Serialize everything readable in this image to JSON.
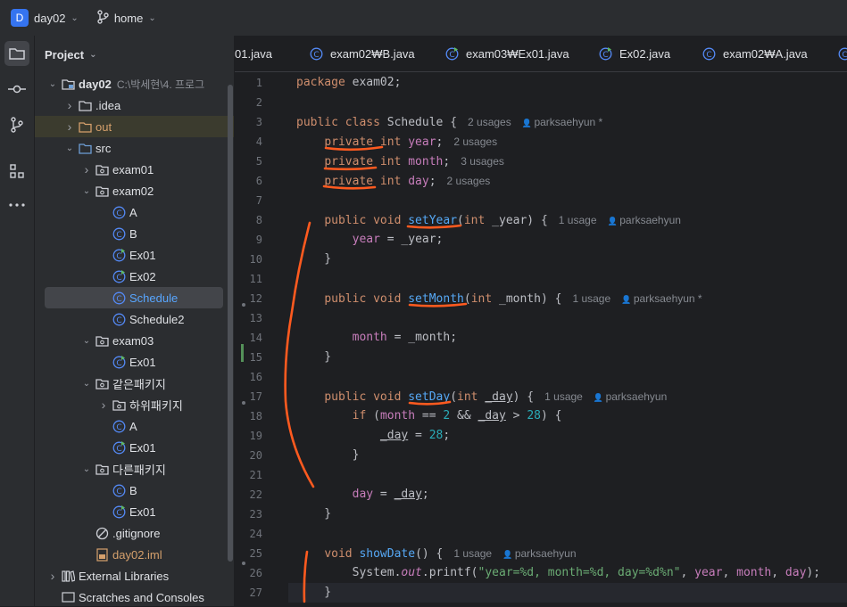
{
  "titlebar": {
    "project_badge": "D",
    "project_name": "day02",
    "branch": "home"
  },
  "toolstrip": {
    "icons": [
      "folder-icon",
      "commit-icon",
      "git-branches-icon",
      "structure-icon",
      "more-icon"
    ]
  },
  "project_panel": {
    "header": "Project",
    "tree": [
      {
        "label": "day02",
        "extra": "C:\\박세현\\4. 프로그",
        "level": 0,
        "expanded": true,
        "icon": "module-folder",
        "bold": true
      },
      {
        "label": ".idea",
        "level": 1,
        "expanded": false,
        "icon": "folder"
      },
      {
        "label": "out",
        "level": 1,
        "expanded": false,
        "icon": "folder-orange",
        "color": "orange",
        "highlight": true
      },
      {
        "label": "src",
        "level": 1,
        "expanded": true,
        "icon": "source-folder"
      },
      {
        "label": "exam01",
        "level": 2,
        "expanded": false,
        "icon": "package"
      },
      {
        "label": "exam02",
        "level": 2,
        "expanded": true,
        "icon": "package"
      },
      {
        "label": "A",
        "level": 3,
        "icon": "class"
      },
      {
        "label": "B",
        "level": 3,
        "icon": "class"
      },
      {
        "label": "Ex01",
        "level": 3,
        "icon": "class-runnable"
      },
      {
        "label": "Ex02",
        "level": 3,
        "icon": "class-runnable"
      },
      {
        "label": "Schedule",
        "level": 3,
        "icon": "class",
        "selected": true,
        "color": "blue"
      },
      {
        "label": "Schedule2",
        "level": 3,
        "icon": "class"
      },
      {
        "label": "exam03",
        "level": 2,
        "expanded": true,
        "icon": "package"
      },
      {
        "label": "Ex01",
        "level": 3,
        "icon": "class-runnable"
      },
      {
        "label": "같은패키지",
        "level": 2,
        "expanded": true,
        "icon": "package"
      },
      {
        "label": "하위패키지",
        "level": 3,
        "expanded": false,
        "icon": "package"
      },
      {
        "label": "A",
        "level": 3,
        "icon": "class"
      },
      {
        "label": "Ex01",
        "level": 3,
        "icon": "class-runnable"
      },
      {
        "label": "다른패키지",
        "level": 2,
        "expanded": true,
        "icon": "package"
      },
      {
        "label": "B",
        "level": 3,
        "icon": "class"
      },
      {
        "label": "Ex01",
        "level": 3,
        "icon": "class-runnable"
      },
      {
        "label": ".gitignore",
        "level": 2,
        "icon": "ignore-file"
      },
      {
        "label": "day02.iml",
        "level": 2,
        "icon": "iml-file",
        "color": "orange"
      },
      {
        "label": "External Libraries",
        "level": 0,
        "expanded": false,
        "icon": "libraries"
      },
      {
        "label": "Scratches and Consoles",
        "level": 0,
        "icon": "scratches"
      }
    ]
  },
  "tabs": [
    {
      "label": "01.java",
      "icon": "none"
    },
    {
      "label": "exam02₩B.java",
      "icon": "class"
    },
    {
      "label": "exam03₩Ex01.java",
      "icon": "class-runnable"
    },
    {
      "label": "Ex02.java",
      "icon": "class-runnable"
    },
    {
      "label": "exam02₩A.java",
      "icon": "class"
    },
    {
      "label": "",
      "icon": "class"
    }
  ],
  "editor": {
    "current_line": 27,
    "lines": [
      {
        "n": "1",
        "code": [
          [
            "kw",
            "package "
          ],
          [
            "",
            "exam02;"
          ]
        ]
      },
      {
        "n": "2",
        "code": []
      },
      {
        "n": "3",
        "code": [
          [
            "kw",
            "public class "
          ],
          [
            "",
            "Schedule {"
          ]
        ],
        "hint": "2 usages",
        "user": "parksaehyun *"
      },
      {
        "n": "4",
        "code": [
          [
            "",
            "    "
          ],
          [
            "kw",
            "private int "
          ],
          [
            "fld",
            "year"
          ],
          [
            "",
            ";"
          ]
        ],
        "hint": "2 usages"
      },
      {
        "n": "5",
        "code": [
          [
            "",
            "    "
          ],
          [
            "kw",
            "private int "
          ],
          [
            "fld",
            "month"
          ],
          [
            "",
            ";"
          ]
        ],
        "hint": "3 usages"
      },
      {
        "n": "6",
        "code": [
          [
            "",
            "    "
          ],
          [
            "kw",
            "private int "
          ],
          [
            "fld",
            "day"
          ],
          [
            "",
            ";"
          ]
        ],
        "hint": "2 usages"
      },
      {
        "n": "7",
        "code": []
      },
      {
        "n": "8",
        "code": [
          [
            "",
            "    "
          ],
          [
            "kw",
            "public void "
          ],
          [
            "fn",
            "setYear"
          ],
          [
            "",
            "("
          ],
          [
            "kw",
            "int "
          ],
          [
            "",
            "_year) {"
          ]
        ],
        "hint": "1 usage",
        "user": "parksaehyun"
      },
      {
        "n": "9",
        "code": [
          [
            "",
            "        "
          ],
          [
            "fld",
            "year"
          ],
          [
            "",
            " = _year;"
          ]
        ]
      },
      {
        "n": "10",
        "code": [
          [
            "",
            "    }"
          ]
        ]
      },
      {
        "n": "11",
        "code": []
      },
      {
        "n": "12",
        "code": [
          [
            "",
            "    "
          ],
          [
            "kw",
            "public void "
          ],
          [
            "fn",
            "setMonth"
          ],
          [
            "",
            "("
          ],
          [
            "kw",
            "int "
          ],
          [
            "",
            "_month) {"
          ]
        ],
        "hint": "1 usage",
        "user": "parksaehyun *"
      },
      {
        "n": "13",
        "code": []
      },
      {
        "n": "14",
        "code": [
          [
            "",
            "        "
          ],
          [
            "fld",
            "month"
          ],
          [
            "",
            " = _month;"
          ]
        ]
      },
      {
        "n": "15",
        "code": [
          [
            "",
            "    }"
          ]
        ]
      },
      {
        "n": "16",
        "code": []
      },
      {
        "n": "17",
        "code": [
          [
            "",
            "    "
          ],
          [
            "kw",
            "public void "
          ],
          [
            "fn",
            "setDay"
          ],
          [
            "",
            "("
          ],
          [
            "kw",
            "int "
          ],
          [
            "ul",
            "_day"
          ],
          [
            "",
            ") {"
          ]
        ],
        "hint": "1 usage",
        "user": "parksaehyun"
      },
      {
        "n": "18",
        "code": [
          [
            "",
            "        "
          ],
          [
            "kw",
            "if "
          ],
          [
            "",
            "("
          ],
          [
            "fld",
            "month"
          ],
          [
            "",
            " == "
          ],
          [
            "num",
            "2"
          ],
          [
            "",
            " && "
          ],
          [
            "ul",
            "_day"
          ],
          [
            "",
            " > "
          ],
          [
            "num",
            "28"
          ],
          [
            "",
            ") {"
          ]
        ]
      },
      {
        "n": "19",
        "code": [
          [
            "",
            "            "
          ],
          [
            "ul",
            "_day"
          ],
          [
            "",
            " = "
          ],
          [
            "num",
            "28"
          ],
          [
            "",
            ";"
          ]
        ]
      },
      {
        "n": "20",
        "code": [
          [
            "",
            "        }"
          ]
        ]
      },
      {
        "n": "21",
        "code": []
      },
      {
        "n": "22",
        "code": [
          [
            "",
            "        "
          ],
          [
            "fld",
            "day"
          ],
          [
            "",
            " = "
          ],
          [
            "ul",
            "_day"
          ],
          [
            "",
            ";"
          ]
        ]
      },
      {
        "n": "23",
        "code": [
          [
            "",
            "    }"
          ]
        ]
      },
      {
        "n": "24",
        "code": []
      },
      {
        "n": "25",
        "code": [
          [
            "",
            "    "
          ],
          [
            "kw",
            "void "
          ],
          [
            "fn",
            "showDate"
          ],
          [
            "",
            "() {"
          ]
        ],
        "hint": "1 usage",
        "user": "parksaehyun"
      },
      {
        "n": "26",
        "code": [
          [
            "",
            "        System."
          ],
          [
            "fldit",
            "out"
          ],
          [
            "",
            ".printf("
          ],
          [
            "str",
            "\"year=%d, month=%d, day=%d%n\""
          ],
          [
            "",
            ", "
          ],
          [
            "fld",
            "year"
          ],
          [
            "",
            ", "
          ],
          [
            "fld",
            "month"
          ],
          [
            "",
            ", "
          ],
          [
            "fld",
            "day"
          ],
          [
            "",
            ");"
          ]
        ]
      },
      {
        "n": "27",
        "code": [
          [
            "",
            "    }"
          ]
        ]
      }
    ]
  },
  "colors": {
    "background": "#1e1f22",
    "panel": "#2b2d30",
    "keyword": "#cf8e6d",
    "function": "#56a8f5",
    "field": "#c77dbb",
    "number": "#2aacb8",
    "string": "#6aab73",
    "annotation": "#ff5a1f",
    "badge": "#3574f0"
  }
}
